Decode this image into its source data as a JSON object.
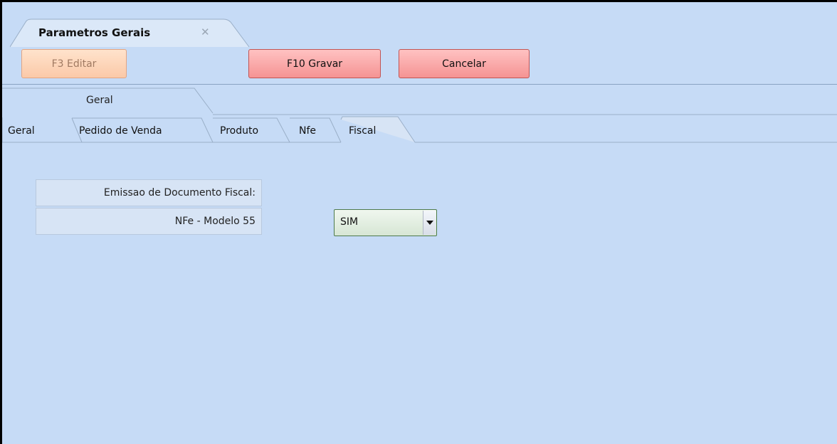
{
  "document_tab": {
    "title": "Parametros Gerais",
    "close_icon": "close-icon"
  },
  "toolbar": {
    "edit_label": "F3 Editar",
    "save_label": "F10 Gravar",
    "cancel_label": "Cancelar"
  },
  "group_tab": {
    "label": "Geral"
  },
  "subtabs": {
    "items": [
      {
        "label": "Geral"
      },
      {
        "label": "Pedido de Venda"
      },
      {
        "label": "Produto"
      },
      {
        "label": "Nfe"
      },
      {
        "label": "Fiscal",
        "active": true
      }
    ]
  },
  "form": {
    "section_label": "Emissao de Documento Fiscal:",
    "nfe_label": "NFe - Modelo 55",
    "nfe_value": "SIM"
  },
  "colors": {
    "background": "#c6dbf6",
    "button_primary": "#f59393",
    "button_disabled": "#fbc9a8"
  }
}
